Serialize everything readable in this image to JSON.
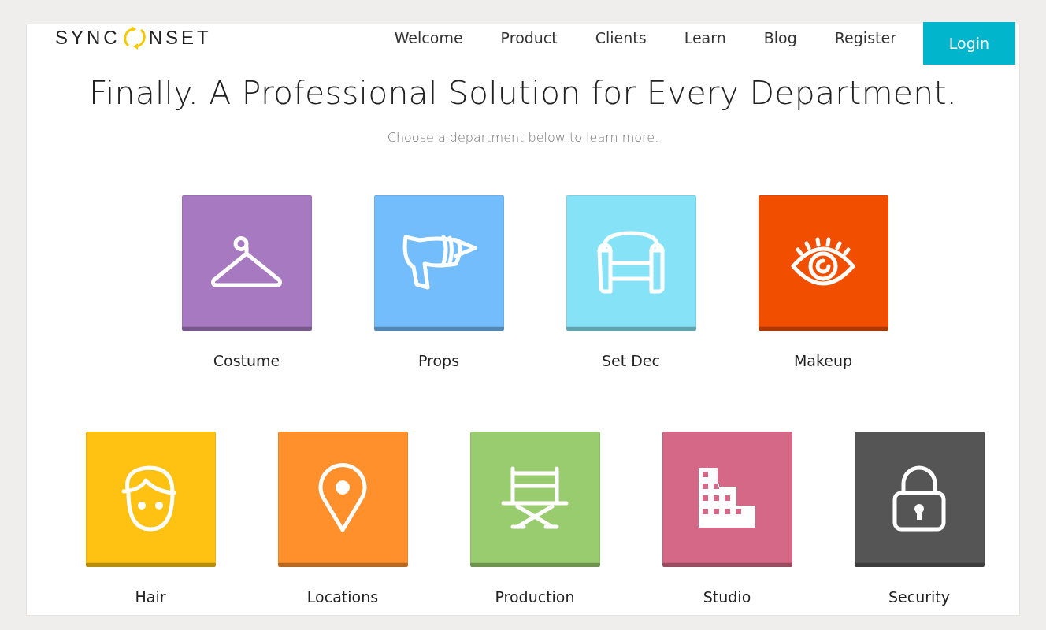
{
  "logo": {
    "before": "SYNC",
    "after": "NSET"
  },
  "nav": [
    {
      "label": "Welcome",
      "kind": "link"
    },
    {
      "label": "Product",
      "kind": "link"
    },
    {
      "label": "Clients",
      "kind": "link"
    },
    {
      "label": "Learn",
      "kind": "link"
    },
    {
      "label": "Blog",
      "kind": "link"
    },
    {
      "label": "Register",
      "kind": "link"
    },
    {
      "label": "Login",
      "kind": "button"
    }
  ],
  "heading": "Finally. A Professional Solution for Every Department.",
  "subheading": "Choose a department below to learn more.",
  "rows": [
    [
      {
        "label": "Costume",
        "kind": "hanger",
        "color": "#a779c1"
      },
      {
        "label": "Props",
        "kind": "gun",
        "color": "#74bdfc"
      },
      {
        "label": "Set Dec",
        "kind": "armchair",
        "color": "#86e3f7"
      },
      {
        "label": "Makeup",
        "kind": "eye",
        "color": "#f24e00"
      }
    ],
    [
      {
        "label": "Hair",
        "kind": "face",
        "color": "#ffc212"
      },
      {
        "label": "Locations",
        "kind": "pin",
        "color": "#ff902c"
      },
      {
        "label": "Production",
        "kind": "chair",
        "color": "#98cc6e"
      },
      {
        "label": "Studio",
        "kind": "building",
        "color": "#d46886"
      },
      {
        "label": "Security",
        "kind": "lock",
        "color": "#555555"
      }
    ]
  ]
}
